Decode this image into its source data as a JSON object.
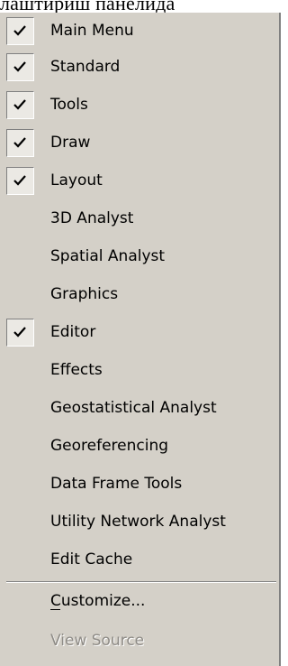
{
  "top_text": "лаштириш панелида",
  "menu": {
    "items": [
      {
        "label": "Main Menu",
        "checked": true
      },
      {
        "label": "Standard",
        "checked": true
      },
      {
        "label": "Tools",
        "checked": true
      },
      {
        "label": "Draw",
        "checked": true
      },
      {
        "label": "Layout",
        "checked": true
      },
      {
        "label": "3D Analyst",
        "checked": false
      },
      {
        "label": "Spatial Analyst",
        "checked": false
      },
      {
        "label": "Graphics",
        "checked": false
      },
      {
        "label": "Editor",
        "checked": true
      },
      {
        "label": "Effects",
        "checked": false
      },
      {
        "label": "Geostatistical Analyst",
        "checked": false
      },
      {
        "label": "Georeferencing",
        "checked": false
      },
      {
        "label": "Data Frame Tools",
        "checked": false
      },
      {
        "label": "Utility Network Analyst",
        "checked": false
      },
      {
        "label": "Edit Cache",
        "checked": false
      }
    ],
    "customize_label": "Customize...",
    "view_source_label": "View Source",
    "view_source_enabled": false
  },
  "colors": {
    "menu_background": "#d4d0c8",
    "check_background": "#ebe9e4",
    "disabled_text": "#8e8b86"
  },
  "icons": {
    "checkmark": "checkmark-icon"
  }
}
